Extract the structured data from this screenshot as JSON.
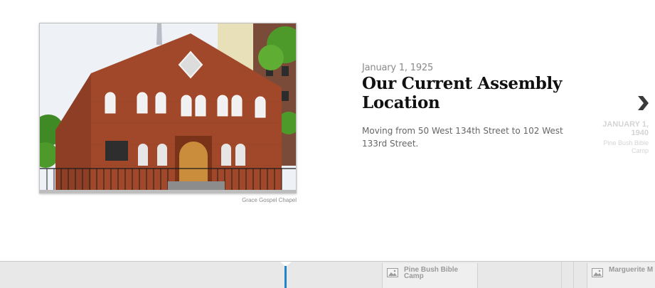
{
  "slide": {
    "date": "January 1, 1925",
    "title_line1": "Our Current Assembly",
    "title_line2": "Location",
    "body": "Moving from 50 West 134th Street to 102 West 133rd Street.",
    "photo_credit": "Grace Gospel Chapel"
  },
  "next_preview": {
    "date_line1": "JANUARY 1,",
    "date_line2": "1940",
    "title_line1": "Pine Bush Bible",
    "title_line2": "Camp",
    "arrow_icon": "chevron-right-icon"
  },
  "timenav": {
    "items": [
      {
        "line1": "Pine Bush Bible",
        "line2": "Camp",
        "icon": "image-icon"
      },
      {
        "line1": "Marguerite M",
        "line2": "",
        "icon": "image-icon"
      }
    ],
    "marker_color": "#1f84c9"
  },
  "colors": {
    "title": "#111111",
    "date": "#8a8a8a",
    "body": "#666666",
    "faded": "#d4d4d4"
  }
}
